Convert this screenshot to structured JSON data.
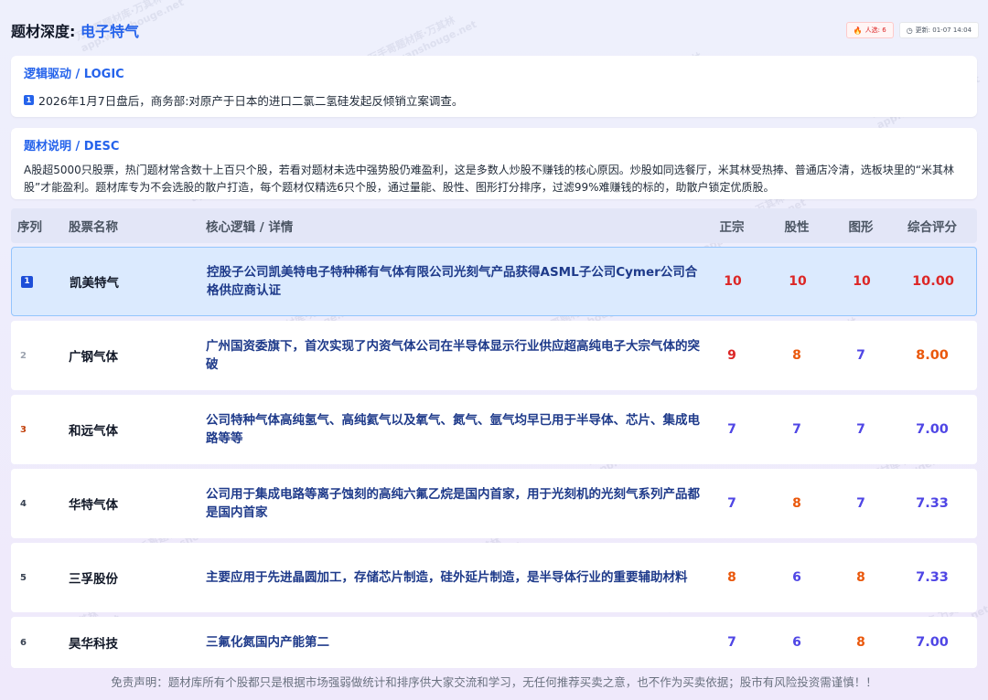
{
  "header": {
    "title_prefix": "题材深度: ",
    "topic": "电子特气",
    "hot_badge": "人选: 6",
    "hot_icon": "flame-icon",
    "time_badge": "更新: 01-07 14:04",
    "time_icon": "clock-icon"
  },
  "logic": {
    "title": "逻辑驱动 / LOGIC",
    "items": [
      {
        "num": "1",
        "text": "2026年1月7日盘后，商务部:对原产于日本的进口二氯二氢硅发起反倾销立案调查。"
      }
    ]
  },
  "desc": {
    "title": "题材说明 / DESC",
    "text": "A股超5000只股票，热门题材常含数十上百只个股，若看对题材未选中强势股仍难盈利，这是多数人炒股不赚钱的核心原因。炒股如同选餐厅，米其林受热捧、普通店冷清，选板块里的“米其林股”才能盈利。题材库专为不会选股的散户打造，每个题材仅精选6只个股，通过量能、股性、图形打分排序，过滤99%难赚钱的标的，助散户锁定优质股。"
  },
  "table": {
    "headers": {
      "idx": "序列",
      "name": "股票名称",
      "logic": "核心逻辑 / 详情",
      "zhengzong": "正宗",
      "guxing": "股性",
      "tuxing": "图形",
      "score": "综合评分"
    },
    "rows": [
      {
        "idx": "1",
        "name": "凯美特气",
        "logic": "控股子公司凯美特电子特种稀有气体有限公司光刻气产品获得ASML子公司Cymer公司合格供应商认证",
        "zhengzong": "10",
        "guxing": "10",
        "tuxing": "10",
        "score": "10.00"
      },
      {
        "idx": "2",
        "name": "广钢气体",
        "logic": "广州国资委旗下，首次实现了内资气体公司在半导体显示行业供应超高纯电子大宗气体的突破",
        "zhengzong": "9",
        "guxing": "8",
        "tuxing": "7",
        "score": "8.00"
      },
      {
        "idx": "3",
        "name": "和远气体",
        "logic": "公司特种气体高纯氢气、高纯氦气以及氧气、氮气、氩气均早已用于半导体、芯片、集成电路等等",
        "zhengzong": "7",
        "guxing": "7",
        "tuxing": "7",
        "score": "7.00"
      },
      {
        "idx": "4",
        "name": "华特气体",
        "logic": "公司用于集成电路等离子蚀刻的高纯六氟乙烷是国内首家，用于光刻机的光刻气系列产品都是国内首家",
        "zhengzong": "7",
        "guxing": "8",
        "tuxing": "7",
        "score": "7.33"
      },
      {
        "idx": "5",
        "name": "三孚股份",
        "logic": "主要应用于先进晶圆加工，存储芯片制造，硅外延片制造，是半导体行业的重要辅助材料",
        "zhengzong": "8",
        "guxing": "6",
        "tuxing": "8",
        "score": "7.33"
      },
      {
        "idx": "6",
        "name": "昊华科技",
        "logic": "三氟化氮国内产能第二",
        "zhengzong": "7",
        "guxing": "6",
        "tuxing": "8",
        "score": "7.00"
      }
    ]
  },
  "disclaimer": "免责声明：题材库所有个股都只是根据市场强弱做统计和排序供大家交流和学习，无任何推荐买卖之意，也不作为买卖依据；股市有风险投资需谨慎！！",
  "watermark": {
    "line1": "万手哥题材库·万其林",
    "line2": "app.wanshouge.net"
  },
  "colors": {
    "accent": "#2563eb",
    "score_red": "#dc2626",
    "score_orange": "#ea580c",
    "score_purple": "#4f46e5"
  }
}
